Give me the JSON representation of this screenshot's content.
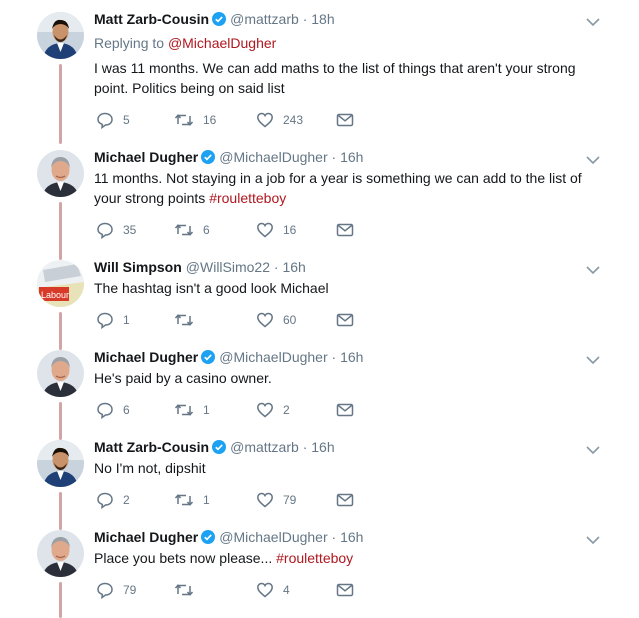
{
  "tweets": [
    {
      "name": "Matt Zarb-Cousin",
      "handle": "@mattzarb",
      "time": "18h",
      "replying_label": "Replying to",
      "replying_to": "@MichaelDugher",
      "text": "I was 11 months. We can add maths to the list of things that aren't your strong point. Politics being on said list",
      "hashtag": "",
      "replies": "5",
      "retweets": "16",
      "likes": "243",
      "avatar": "man-blue-suit"
    },
    {
      "name": "Michael Dugher",
      "handle": "@MichaelDugher",
      "time": "16h",
      "text": "11 months. Not staying in a job for a year is something we can add to the list of your strong points",
      "hashtag": "#rouletteboy",
      "replies": "35",
      "retweets": "6",
      "likes": "16",
      "avatar": "man-grey-hair"
    },
    {
      "name": "Will Simpson",
      "handle": "@WillSimo22",
      "time": "16h",
      "text": "The hashtag isn't a good look Michael",
      "hashtag": "",
      "replies": "1",
      "retweets": "",
      "likes": "60",
      "avatar_label": "Labour"
    },
    {
      "name": "Michael Dugher",
      "handle": "@MichaelDugher",
      "time": "16h",
      "text": "He's paid by a casino owner.",
      "hashtag": "",
      "replies": "6",
      "retweets": "1",
      "likes": "2",
      "avatar": "man-grey-hair"
    },
    {
      "name": "Matt Zarb-Cousin",
      "handle": "@mattzarb",
      "time": "16h",
      "text": "No I'm not, dipshit",
      "hashtag": "",
      "replies": "2",
      "retweets": "1",
      "likes": "79",
      "avatar": "man-blue-suit"
    },
    {
      "name": "Michael Dugher",
      "handle": "@MichaelDugher",
      "time": "16h",
      "text": "Place you bets now please...",
      "hashtag": "#rouletteboy",
      "replies": "79",
      "retweets": "",
      "likes": "4",
      "avatar": "man-grey-hair"
    }
  ],
  "separator": "·",
  "colors": {
    "accent": "#b0171f",
    "muted": "#657786",
    "thread": "#d3a4a4",
    "verified": "#1da1f2"
  },
  "icons": [
    "reply-icon",
    "retweet-icon",
    "like-icon",
    "dm-icon",
    "verified-icon",
    "chevron-down-icon"
  ]
}
